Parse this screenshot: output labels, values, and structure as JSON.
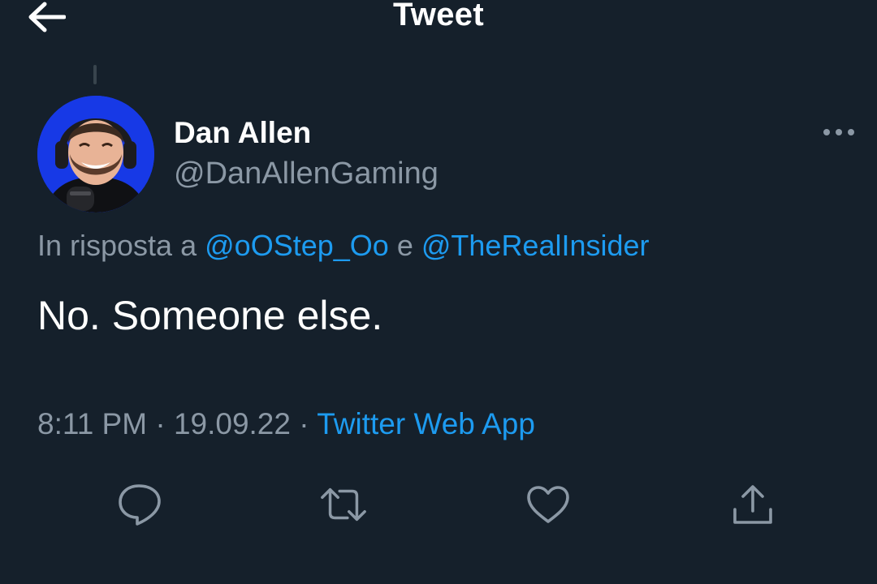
{
  "header": {
    "title": "Tweet",
    "back_icon": "arrow-left-icon"
  },
  "author": {
    "name": "Dan Allen",
    "handle": "@DanAllenGaming",
    "avatar_bg": "#1739e6"
  },
  "reply": {
    "prefix": "In risposta a",
    "mention_1": "@oOStep_Oo",
    "conjunction": "e",
    "mention_2": "@TheRealInsider"
  },
  "tweet": {
    "text": "No. Someone else.",
    "time": "8:11 PM",
    "separator": "·",
    "date": "19.09.22",
    "source": "Twitter Web App"
  },
  "actions": {
    "icons": [
      "reply-icon",
      "retweet-icon",
      "like-icon",
      "share-icon"
    ]
  },
  "colors": {
    "background": "#15202b",
    "primary_text": "#ffffff",
    "secondary_text": "#8b98a5",
    "accent": "#1d9bf0"
  }
}
